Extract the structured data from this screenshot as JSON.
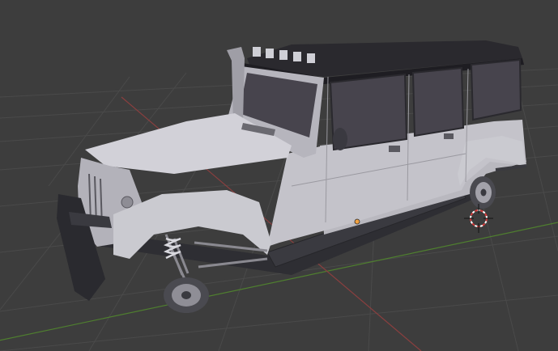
{
  "viewport": {
    "background": "#3d3d3d",
    "grid_color": "#4a4a4a",
    "x_axis_color": "#8a3f3f",
    "y_axis_color": "#4f7f2f",
    "origin_color": "#f0a040",
    "cursor_colors": [
      "#d43a3a",
      "#ffffff"
    ]
  },
  "model": {
    "body_color": "#c4c3ca",
    "roof_color": "#2a292e",
    "window_color": "#47444d",
    "chassis_color": "#2e2e33",
    "selection_outline_color": "#e08a2a"
  }
}
